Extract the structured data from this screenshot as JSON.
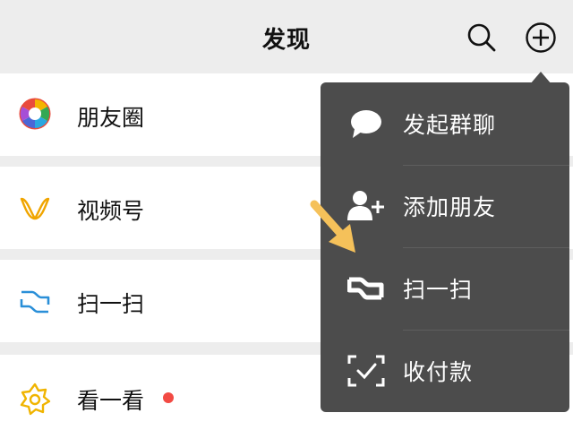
{
  "header": {
    "title": "发现",
    "search_icon": "search-icon",
    "plus_icon": "plus-circle-icon"
  },
  "list": [
    {
      "label": "朋友圈",
      "icon": "moments-icon"
    },
    {
      "label": "视频号",
      "icon": "channels-icon"
    },
    {
      "label": "扫一扫",
      "icon": "scan-icon"
    },
    {
      "label": "看一看",
      "icon": "top-stories-icon",
      "badge": "red-dot"
    }
  ],
  "menu": {
    "items": [
      {
        "label": "发起群聊",
        "icon": "chat-bubble-icon"
      },
      {
        "label": "添加朋友",
        "icon": "add-friend-icon"
      },
      {
        "label": "扫一扫",
        "icon": "scan-icon"
      },
      {
        "label": "收付款",
        "icon": "payment-icon"
      }
    ]
  },
  "colors": {
    "background": "#ededed",
    "menu": "#4c4c4c",
    "badge": "#f24a43",
    "hint_arrow": "#f5c15a"
  }
}
